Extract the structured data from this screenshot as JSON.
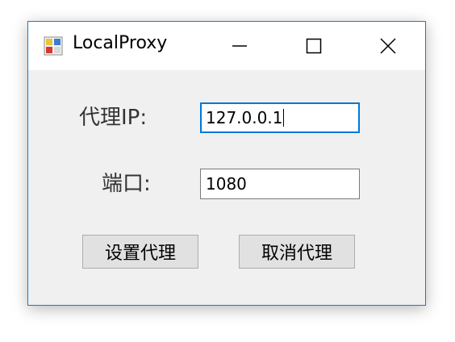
{
  "window": {
    "title": "LocalProxy",
    "controls": {
      "minimize_icon": "minimize-icon",
      "maximize_icon": "maximize-icon",
      "close_icon": "close-icon"
    },
    "accent_color": "#1979ca"
  },
  "form": {
    "proxy_ip_label": "代理IP:",
    "proxy_ip_value": "127.0.0.1",
    "port_label": "端口:",
    "port_value": "1080"
  },
  "buttons": {
    "set_proxy_label": "设置代理",
    "cancel_proxy_label": "取消代理"
  }
}
